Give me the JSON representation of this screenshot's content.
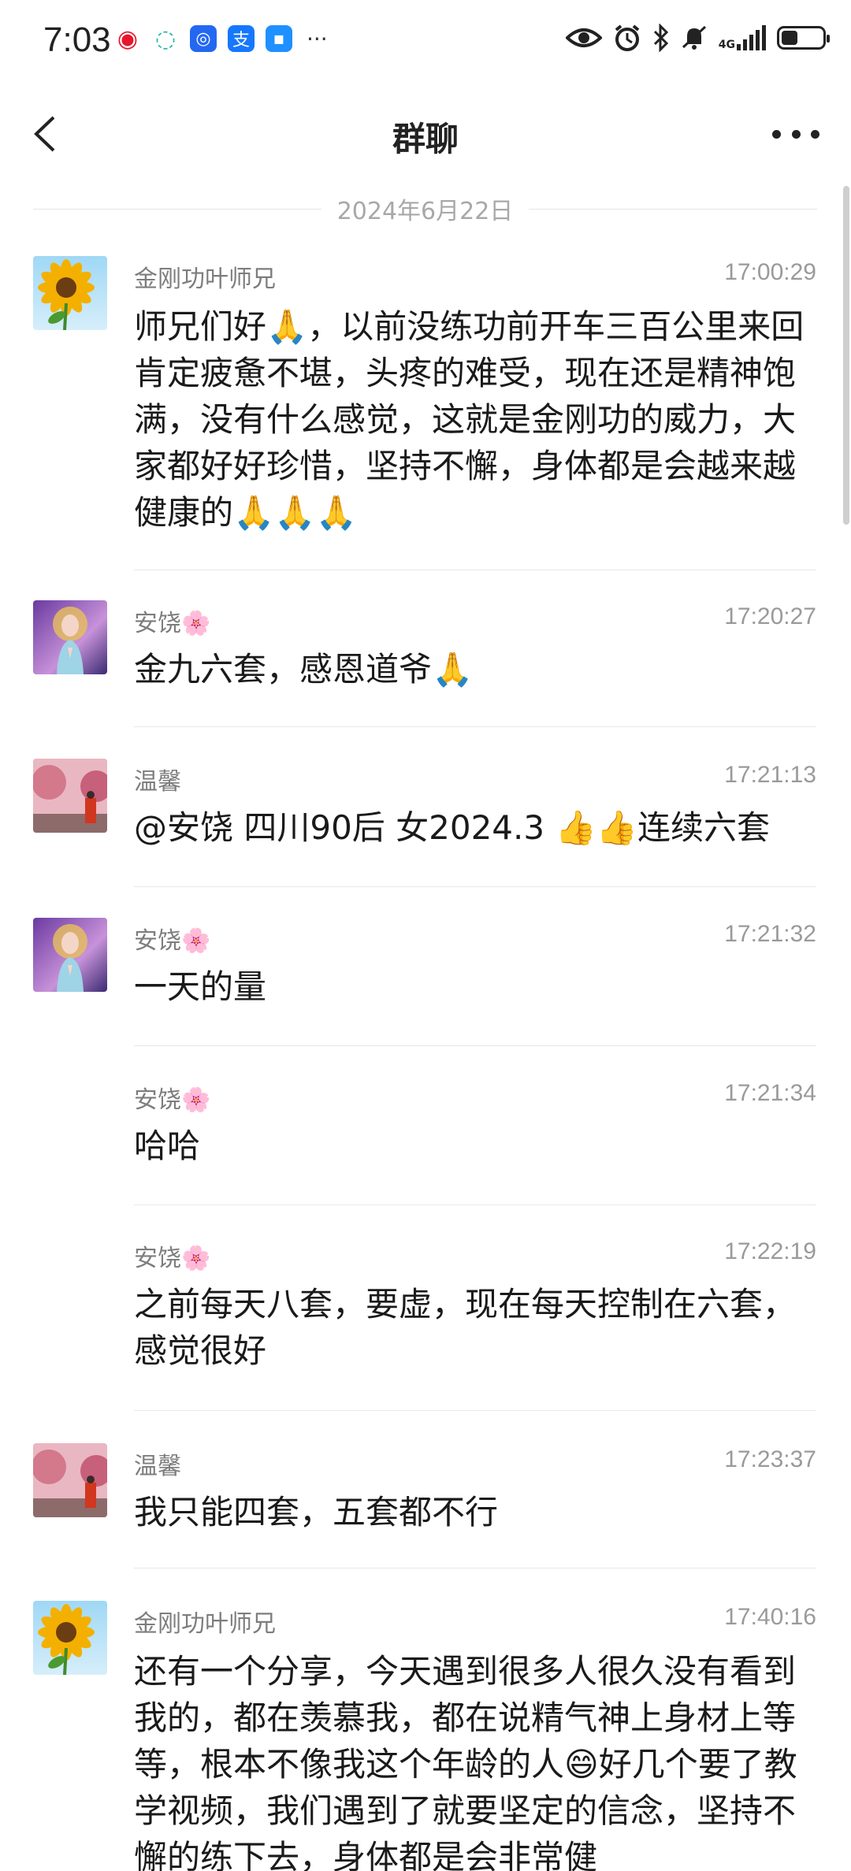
{
  "status_bar": {
    "time": "7:03",
    "apps": [
      {
        "name": "weibo-icon",
        "color": "#e6162d",
        "glyph": "微"
      },
      {
        "name": "quark-icon",
        "color": "#2d88ff",
        "glyph": "Q"
      },
      {
        "name": "baidu-icon",
        "color": "#2468f2",
        "glyph": "◎"
      },
      {
        "name": "alipay-icon",
        "color": "#1677ff",
        "glyph": "支"
      },
      {
        "name": "message-icon",
        "color": "#1e90ff",
        "glyph": "✉"
      }
    ],
    "more": "···",
    "network": "4G"
  },
  "nav": {
    "title": "群聊"
  },
  "date_separator": "2024年6月22日",
  "messages": [
    {
      "sender": "金刚功叶师兄",
      "time": "17:00:29",
      "text": "师兄们好🙏，以前没练功前开车三百公里来回肯定疲惫不堪，头疼的难受，现在还是精神饱满，没有什么感觉，这就是金刚功的威力，大家都好好珍惜，坚持不懈，身体都是会越来越健康的🙏🙏🙏",
      "avatar": "sunflower"
    },
    {
      "sender": "安饶🌸",
      "time": "17:20:27",
      "text": "金九六套，感恩道爷🙏",
      "avatar": "goddess"
    },
    {
      "sender": "温馨",
      "time": "17:21:13",
      "text": "@安饶 四川90后 女2024.3 👍👍连续六套",
      "avatar": "blossom"
    },
    {
      "sender": "安饶🌸",
      "time": "17:21:32",
      "text": "一天的量",
      "avatar": "goddess"
    },
    {
      "sender": "安饶🌸",
      "time": "17:21:34",
      "text": "哈哈",
      "avatar": "none"
    },
    {
      "sender": "安饶🌸",
      "time": "17:22:19",
      "text": "之前每天八套，要虚，现在每天控制在六套，感觉很好",
      "avatar": "none"
    },
    {
      "sender": "温馨",
      "time": "17:23:37",
      "text": "我只能四套，五套都不行",
      "avatar": "blossom"
    },
    {
      "sender": "金刚功叶师兄",
      "time": "17:40:16",
      "text": "还有一个分享，今天遇到很多人很久没有看到我的，都在羡慕我，都在说精气神上身材上等等，根本不像我这个年龄的人😄好几个要了教学视频，我们遇到了就要坚定的信念，坚持不懈的练下去，身体都是会非常健",
      "avatar": "sunflower"
    }
  ]
}
